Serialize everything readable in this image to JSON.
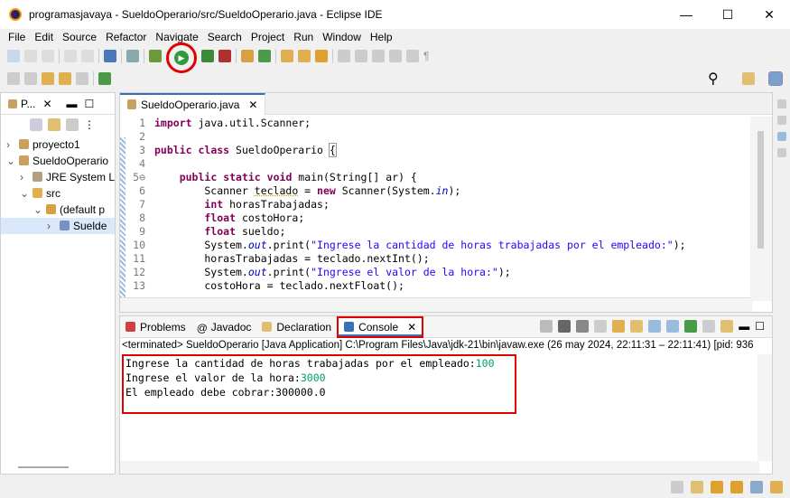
{
  "window": {
    "title": "programasjavaya - SueldoOperario/src/SueldoOperario.java - Eclipse IDE",
    "minimize": "—",
    "maximize": "☐",
    "close": "✕"
  },
  "menu": [
    "File",
    "Edit",
    "Source",
    "Refactor",
    "Navigate",
    "Search",
    "Project",
    "Run",
    "Window",
    "Help"
  ],
  "package_explorer": {
    "tab": "P...",
    "items": [
      {
        "label": "proyecto1",
        "depth": 0,
        "arrow": "›"
      },
      {
        "label": "SueldoOperario",
        "depth": 0,
        "arrow": "⌄"
      },
      {
        "label": "JRE System L",
        "depth": 1,
        "arrow": "›"
      },
      {
        "label": "src",
        "depth": 1,
        "arrow": "⌄"
      },
      {
        "label": "(default p",
        "depth": 2,
        "arrow": "⌄"
      },
      {
        "label": "Suelde",
        "depth": 3,
        "arrow": "›"
      }
    ]
  },
  "editor": {
    "tab": "SueldoOperario.java",
    "lines": [
      {
        "n": "1",
        "html": "<span class='kw'>import</span> java.util.Scanner;"
      },
      {
        "n": "2",
        "html": ""
      },
      {
        "n": "3",
        "html": "<span class='kw'>public</span> <span class='kw'>class</span> SueldoOperario <span style='outline:1px solid #999'>{</span>"
      },
      {
        "n": "4",
        "html": ""
      },
      {
        "n": "5⊖",
        "html": "    <span class='kw'>public</span> <span class='kw'>static</span> <span class='kw'>void</span> main(String[] ar) {"
      },
      {
        "n": "6",
        "html": "        Scanner <span style='text-decoration:underline dotted #c8a000'>teclado</span> = <span class='kw'>new</span> Scanner(System.<span class='fld'>in</span>);"
      },
      {
        "n": "7",
        "html": "        <span class='kw'>int</span> horasTrabajadas;"
      },
      {
        "n": "8",
        "html": "        <span class='kw'>float</span> costoHora;"
      },
      {
        "n": "9",
        "html": "        <span class='kw'>float</span> sueldo;"
      },
      {
        "n": "10",
        "html": "        System.<span class='fld'>out</span>.print(<span class='str'>\"Ingrese la cantidad de horas trabajadas por el empleado:\"</span>);"
      },
      {
        "n": "11",
        "html": "        horasTrabajadas = teclado.nextInt();"
      },
      {
        "n": "12",
        "html": "        System.<span class='fld'>out</span>.print(<span class='str'>\"Ingrese el valor de la hora:\"</span>);"
      },
      {
        "n": "13",
        "html": "        costoHora = teclado.nextFloat();"
      }
    ]
  },
  "bottom_tabs": [
    "Problems",
    "Javadoc",
    "Declaration",
    "Console"
  ],
  "console": {
    "status": "<terminated> SueldoOperario [Java Application] C:\\Program Files\\Java\\jdk-21\\bin\\javaw.exe  (26 may 2024, 22:11:31 – 22:11:41) [pid: 936",
    "lines": [
      {
        "text": "Ingrese la cantidad de horas trabajadas por el empleado:",
        "input": "100"
      },
      {
        "text": "Ingrese el valor de la hora:",
        "input": "3000"
      },
      {
        "text": "El empleado debe cobrar:300000.0",
        "input": ""
      }
    ]
  },
  "colors": {
    "highlight": "#e00000",
    "input": "#00a060"
  }
}
